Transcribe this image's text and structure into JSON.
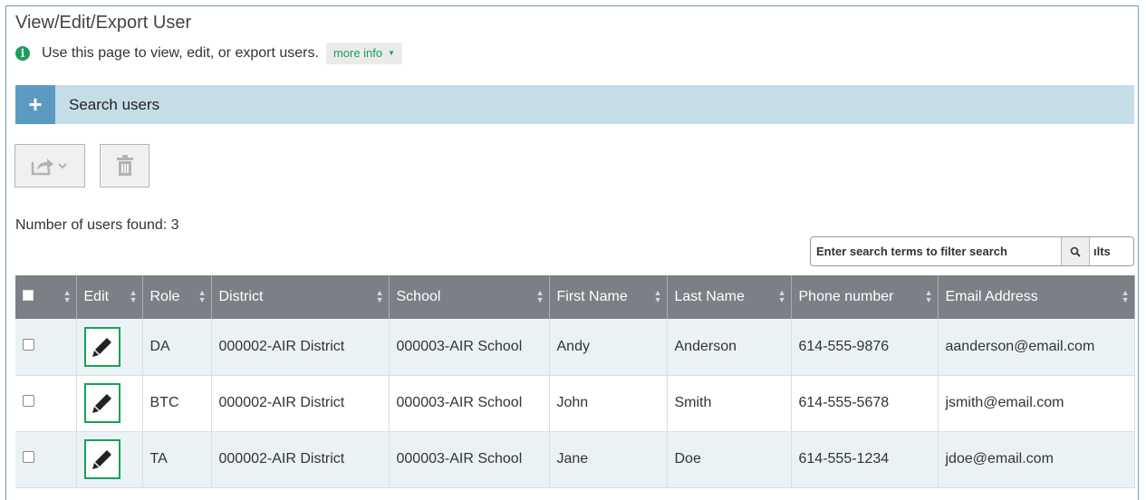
{
  "page": {
    "title": "View/Edit/Export User",
    "info_text": "Use this page to view, edit, or export users.",
    "more_info_label": "more info"
  },
  "search": {
    "label": "Search users"
  },
  "toolbar": {
    "export_icon": "export-icon",
    "delete_icon": "trash-icon"
  },
  "results": {
    "count_text": "Number of users found: 3"
  },
  "filter": {
    "placeholder": "Enter search terms to filter search",
    "tail_text": "ılts"
  },
  "table": {
    "headers": {
      "edit": "Edit",
      "role": "Role",
      "district": "District",
      "school": "School",
      "first_name": "First Name",
      "last_name": "Last Name",
      "phone": "Phone number",
      "email": "Email Address"
    },
    "rows": [
      {
        "role": "DA",
        "district": "000002-AIR District",
        "school": "000003-AIR School",
        "first_name": "Andy",
        "last_name": "Anderson",
        "phone": "614-555-9876",
        "email": "aanderson@email.com"
      },
      {
        "role": "BTC",
        "district": "000002-AIR District",
        "school": "000003-AIR School",
        "first_name": "John",
        "last_name": "Smith",
        "phone": "614-555-5678",
        "email": "jsmith@email.com"
      },
      {
        "role": "TA",
        "district": "000002-AIR District",
        "school": "000003-AIR School",
        "first_name": "Jane",
        "last_name": "Doe",
        "phone": "614-555-1234",
        "email": "jdoe@email.com"
      }
    ]
  },
  "colors": {
    "accent_green": "#18a05a",
    "header_gray": "#7a8085",
    "search_bar": "#c5dde6",
    "search_plus": "#5b9bc1"
  }
}
